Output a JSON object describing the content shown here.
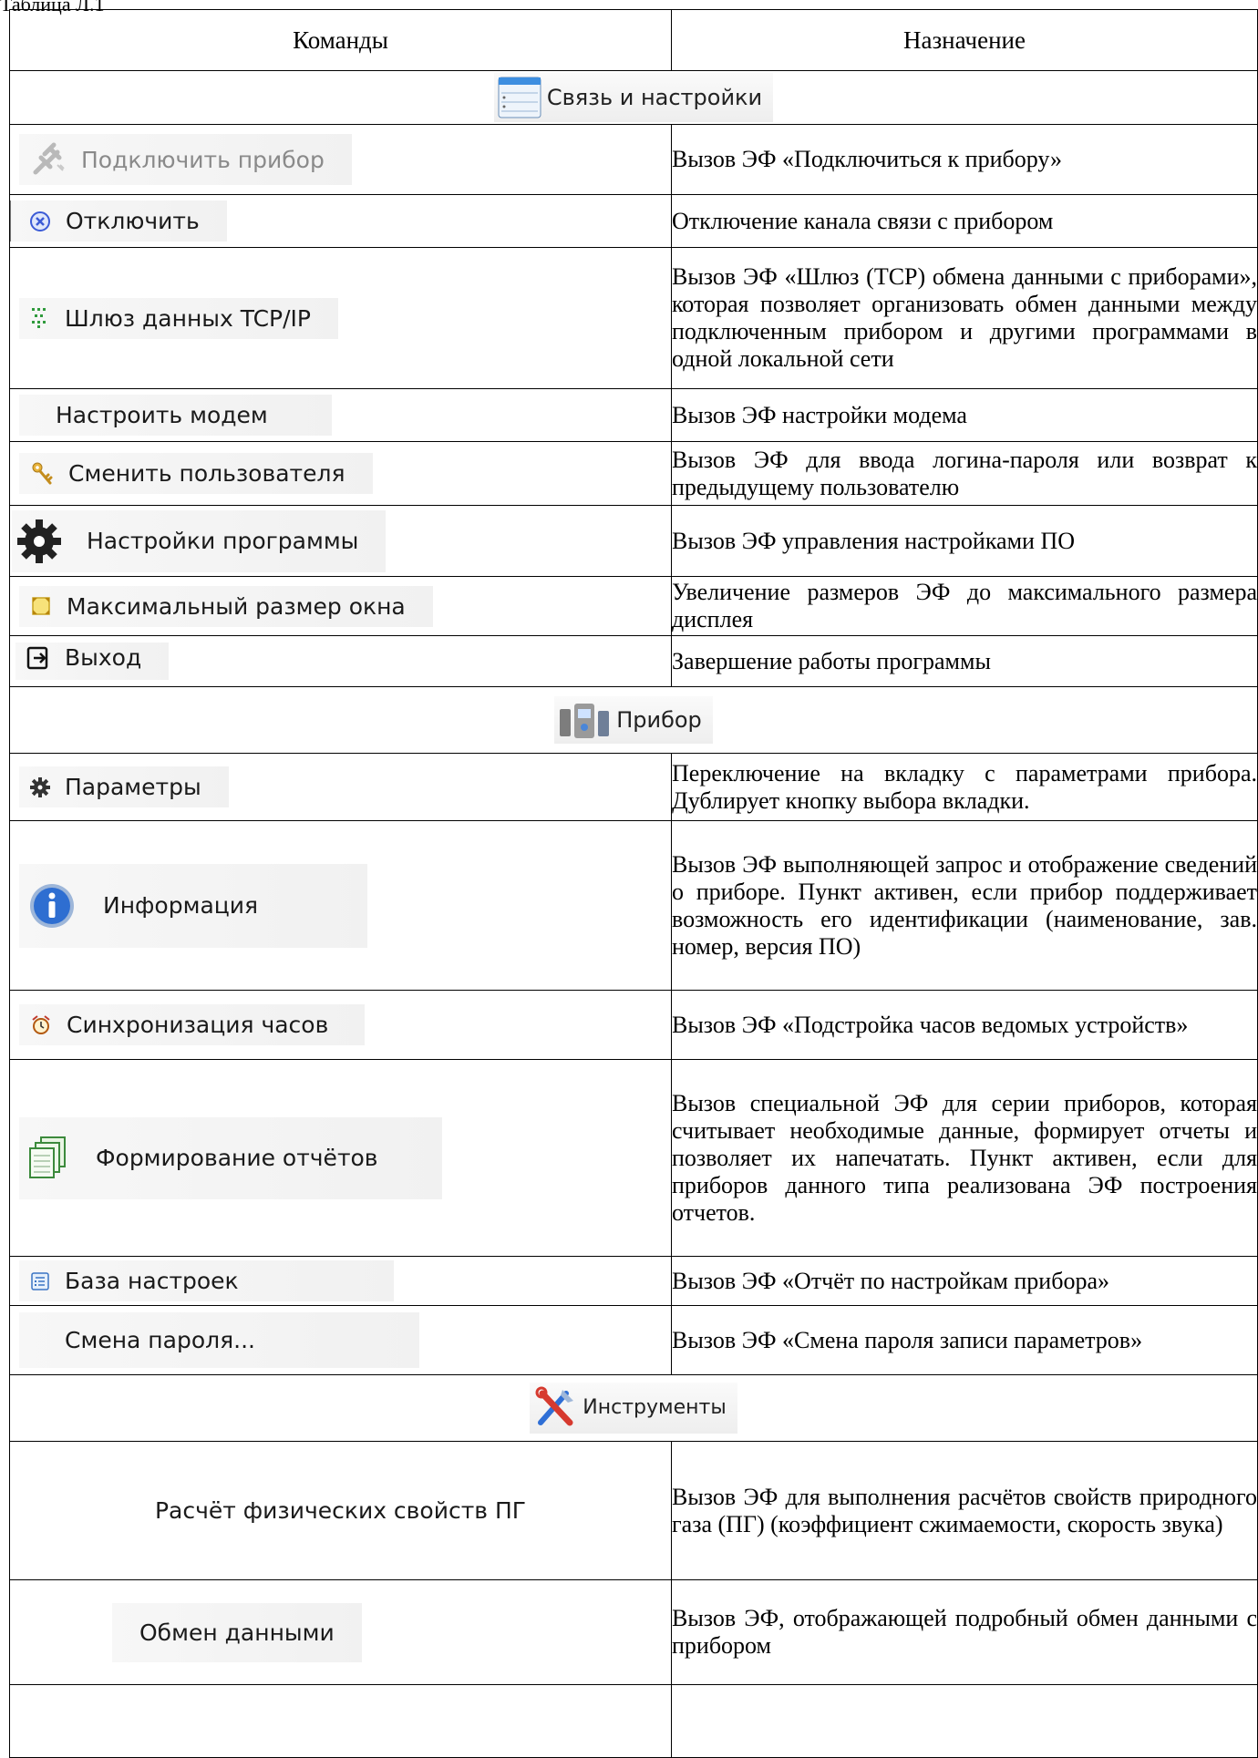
{
  "caption": "Таблица Л.1",
  "headers": {
    "commands": "Команды",
    "purpose": "Назначение"
  },
  "sections": [
    {
      "title": "Связь и настройки",
      "icon": "panel-list-icon",
      "rows": [
        {
          "command": "Подключить прибор",
          "icon": "plug-icon",
          "purpose": "Вызов ЭФ «Подключиться к прибору»"
        },
        {
          "command": "Отключить",
          "icon": "close-circle-icon",
          "purpose": "Отключение канала связи с прибором"
        },
        {
          "command": "Шлюз данных TCP/IP",
          "icon": "network-gateway-icon",
          "purpose": "Вызов ЭФ «Шлюз (TCP) обмена данными с приборами», которая позволяет организовать обмен данными между подключенным прибором и другими программами в одной локальной сети"
        },
        {
          "command": "Настроить модем",
          "icon": "",
          "purpose": "Вызов ЭФ настройки модема"
        },
        {
          "command": "Сменить пользователя",
          "icon": "keys-icon",
          "purpose": "Вызов ЭФ для ввода логина-пароля или возврат к предыдущему пользователю"
        },
        {
          "command": "Настройки программы",
          "icon": "gear-icon",
          "purpose": "Вызов ЭФ управления настройками ПО"
        },
        {
          "command": "Максимальный размер окна",
          "icon": "maximize-icon",
          "purpose": "Увеличение размеров ЭФ до максимального размера дисплея"
        },
        {
          "command": "Выход",
          "icon": "exit-icon",
          "purpose": "Завершение работы программы"
        }
      ]
    },
    {
      "title": "Прибор",
      "icon": "device-icon",
      "rows": [
        {
          "command": "Параметры",
          "icon": "small-gear-icon",
          "purpose": "Переключение на вкладку с параметрами прибора. Дублирует кнопку выбора вкладки."
        },
        {
          "command": "Информация",
          "icon": "info-icon",
          "purpose": "Вызов ЭФ выполняющей запрос и отображение сведений о приборе. Пункт активен, если прибор поддерживает возможность его идентификации (наименование, зав. номер, версия ПО)"
        },
        {
          "command": "Синхронизация часов",
          "icon": "clock-sync-icon",
          "purpose": "Вызов ЭФ «Подстройка часов ведомых устройств»"
        },
        {
          "command": "Формирование отчётов",
          "icon": "reports-stack-icon",
          "purpose": "Вызов специальной ЭФ для серии приборов, которая считывает необходимые данные, формирует отчеты и позволяет их напечатать. Пункт активен, если для приборов данного типа реализована ЭФ построения отчетов."
        },
        {
          "command": "База настроек",
          "icon": "settings-base-icon",
          "purpose": "Вызов ЭФ «Отчёт по настройкам прибора»"
        },
        {
          "command": "Смена пароля...",
          "icon": "",
          "purpose": "Вызов ЭФ «Смена пароля записи параметров»"
        }
      ]
    },
    {
      "title": "Инструменты",
      "icon": "tools-icon",
      "rows": [
        {
          "command": "Расчёт физических свойств ПГ",
          "icon": "",
          "purpose": "Вызов ЭФ для выполнения расчётов свойств природного газа (ПГ) (коэффициент сжимаемости, скорость звука)"
        },
        {
          "command": "Обмен данными",
          "icon": "",
          "purpose": "Вызов ЭФ, отображающей подробный обмен данными с прибором"
        },
        {
          "command": "",
          "icon": "",
          "purpose": ""
        }
      ]
    }
  ]
}
